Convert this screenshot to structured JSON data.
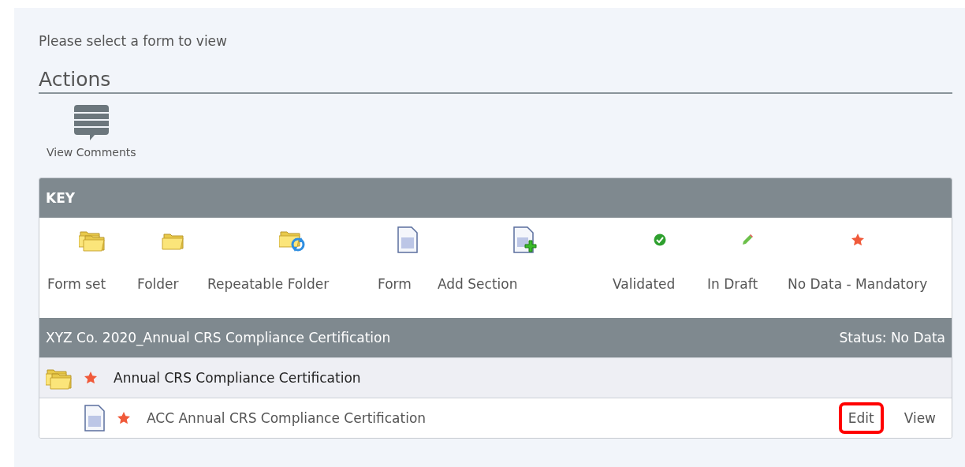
{
  "prompt": "Please select a form to view",
  "actions": {
    "title": "Actions",
    "items": [
      {
        "label": "View Comments"
      }
    ]
  },
  "key": {
    "title": "KEY",
    "items": [
      {
        "kind": "form-set",
        "label": "Form set"
      },
      {
        "kind": "folder",
        "label": "Folder"
      },
      {
        "kind": "repeatable-folder",
        "label": "Repeatable Folder"
      },
      {
        "kind": "form",
        "label": "Form"
      },
      {
        "kind": "add-section",
        "label": "Add Section"
      },
      {
        "kind": "validated",
        "label": "Validated"
      },
      {
        "kind": "in-draft",
        "label": "In Draft"
      },
      {
        "kind": "no-data",
        "label": "No Data - Mandatory"
      }
    ]
  },
  "form_set": {
    "title": "XYZ Co. 2020_Annual CRS Compliance Certification",
    "status": "Status: No Data",
    "rows": [
      {
        "kind": "form-set",
        "mandatory_missing": true,
        "label": "Annual CRS Compliance Certification",
        "actions": []
      },
      {
        "kind": "form",
        "mandatory_missing": true,
        "label": "ACC Annual CRS Compliance Certification",
        "actions": [
          {
            "label": "Edit",
            "highlighted": true
          },
          {
            "label": "View",
            "highlighted": false
          }
        ]
      }
    ]
  }
}
